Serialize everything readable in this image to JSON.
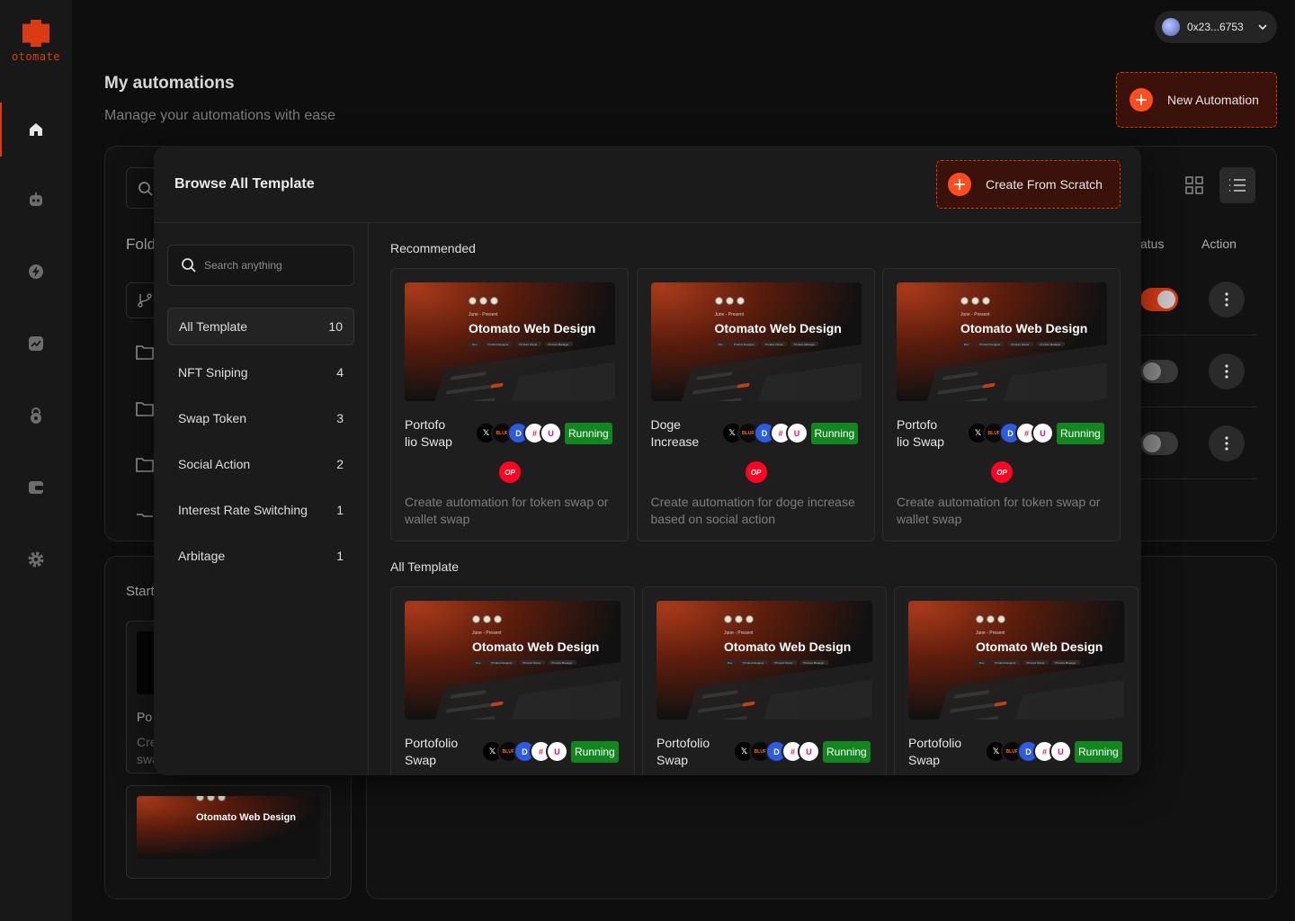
{
  "brand": {
    "name": "otomate",
    "accent": "#d93b14"
  },
  "nav": {
    "items": [
      "home",
      "bot",
      "lightning",
      "chart",
      "lock",
      "wallet",
      "settings"
    ],
    "active": "home"
  },
  "wallet": {
    "address": "0x23...6753"
  },
  "page": {
    "title": "My automations",
    "subtitle": "Manage your automations with ease"
  },
  "actions": {
    "new_automation": "New Automation"
  },
  "background": {
    "folders_label": "Fold",
    "status_col": "atus",
    "action_col": "Action",
    "start_label": "Start",
    "card_name_fragment": "Po",
    "card_desc_fragment_1": "Cre",
    "card_desc_fragment_2": "swa",
    "thumb_title": "Otomato Web Design",
    "rows": [
      {
        "enabled": true
      },
      {
        "enabled": false
      },
      {
        "enabled": false
      }
    ]
  },
  "modal": {
    "title": "Browse All Template",
    "create_button": "Create From Scratch",
    "search_placeholder": "Search anything",
    "categories": [
      {
        "label": "All Template",
        "count": "10",
        "active": true
      },
      {
        "label": "NFT Sniping",
        "count": "4"
      },
      {
        "label": "Swap Token",
        "count": "3"
      },
      {
        "label": "Social Action",
        "count": "2"
      },
      {
        "label": "Interest Rate Switching",
        "count": "1"
      },
      {
        "label": "Arbitage",
        "count": "1"
      }
    ],
    "recommended_label": "Recommended",
    "all_label": "All Template",
    "thumb": {
      "date": "June - Present",
      "title": "Otomato Web Design",
      "tags": [
        "Dev",
        "Product Designer",
        "Product Owner",
        "Product Manager"
      ]
    },
    "recommended": [
      {
        "name": "Portofo lio Swap",
        "status": "Running",
        "op": "OP",
        "desc": "Create automation for token swap or wallet swap"
      },
      {
        "name": "Doge Increase",
        "status": "Running",
        "op": "OP",
        "desc": "Create automation for doge increase based on social action"
      },
      {
        "name": "Portofo lio Swap",
        "status": "Running",
        "op": "OP",
        "desc": "Create automation for token swap or wallet swap"
      }
    ],
    "all_templates": [
      {
        "name": "Portofolio Swap",
        "status": "Running"
      },
      {
        "name": "Portofolio Swap",
        "status": "Running"
      },
      {
        "name": "Portofolio Swap",
        "status": "Running"
      }
    ],
    "chips": [
      {
        "icon": "x-icon",
        "label": "𝕏",
        "color": "#000000"
      },
      {
        "icon": "blur-icon",
        "label": "BLUR",
        "color": "#ff6a00"
      },
      {
        "icon": "discord-icon",
        "label": "D",
        "color": "#2d5be3"
      },
      {
        "icon": "slack-icon",
        "label": "#",
        "color": "#ffffff"
      },
      {
        "icon": "uniswap-icon",
        "label": "U",
        "color": "#ffffff"
      }
    ]
  }
}
